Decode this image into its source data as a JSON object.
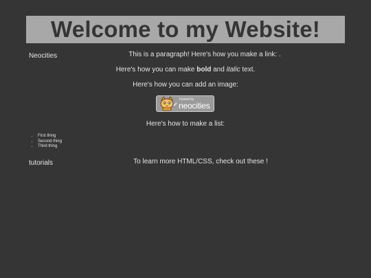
{
  "header": {
    "title": "Welcome to my Website!"
  },
  "sidebar": {
    "link_1": "Neocities",
    "link_2": "tutorials"
  },
  "main": {
    "para_link": "This is a paragraph! Here's how you make a link: .",
    "para_bold_prefix": "Here's how you can make ",
    "para_bold_word": "bold",
    "para_bold_and": " and ",
    "para_italic_word": "italic",
    "para_bold_suffix": " text.",
    "para_image": "Here's how you can add an image:",
    "badge": {
      "hosted_by": "hosted by",
      "brand": "neocities",
      "icon": "neocities-cat-icon"
    },
    "para_list": "Here's how to make a list:",
    "list_items": [
      "First thing",
      "Second thing",
      "Third thing"
    ],
    "para_learn": "To learn more HTML/CSS, check out these !"
  },
  "colors": {
    "background": "#353535",
    "banner": "#a8a8a8",
    "text": "#e6e6e6"
  }
}
